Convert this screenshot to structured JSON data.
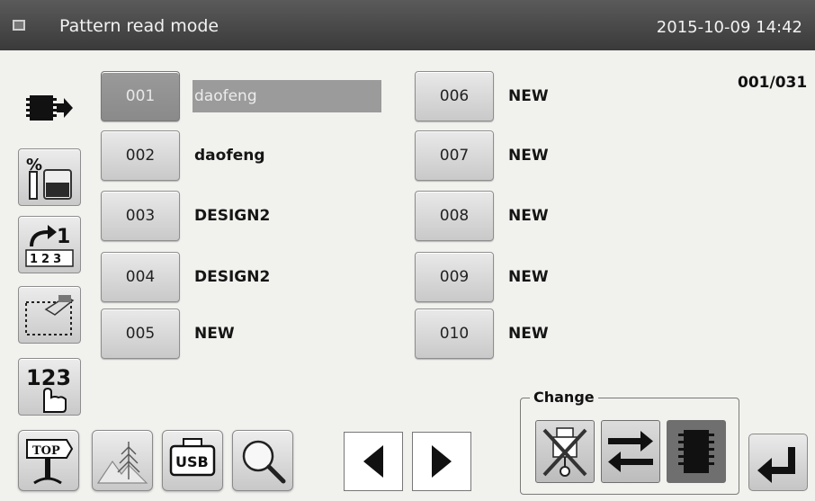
{
  "header": {
    "title": "Pattern read mode",
    "datetime": "2015-10-09 14:42"
  },
  "page_counter": "001/031",
  "patterns_left": [
    {
      "num": "001",
      "name": "daofeng",
      "selected": true
    },
    {
      "num": "002",
      "name": "daofeng",
      "selected": false
    },
    {
      "num": "003",
      "name": "DESIGN2",
      "selected": false
    },
    {
      "num": "004",
      "name": "DESIGN2",
      "selected": false
    },
    {
      "num": "005",
      "name": "NEW",
      "selected": false
    }
  ],
  "patterns_right": [
    {
      "num": "006",
      "name": "NEW",
      "selected": false
    },
    {
      "num": "007",
      "name": "NEW",
      "selected": false
    },
    {
      "num": "008",
      "name": "NEW",
      "selected": false
    },
    {
      "num": "009",
      "name": "NEW",
      "selected": false
    },
    {
      "num": "010",
      "name": "NEW",
      "selected": false
    }
  ],
  "sidebar": {
    "icons": [
      "memory-read-icon",
      "percent-bobbin-icon",
      "step-123-icon",
      "trace-pattern-icon",
      "number-input-icon"
    ],
    "step_glyph": "1",
    "step_digits": "123",
    "number_glyph": "123"
  },
  "bottom": {
    "top_label": "TOP",
    "usb_label": "USB"
  },
  "change": {
    "label": "Change"
  },
  "colors": {
    "titlebar": "#4a4a4a",
    "selected": "#9b9b9b",
    "background": "#f1f1ee"
  }
}
